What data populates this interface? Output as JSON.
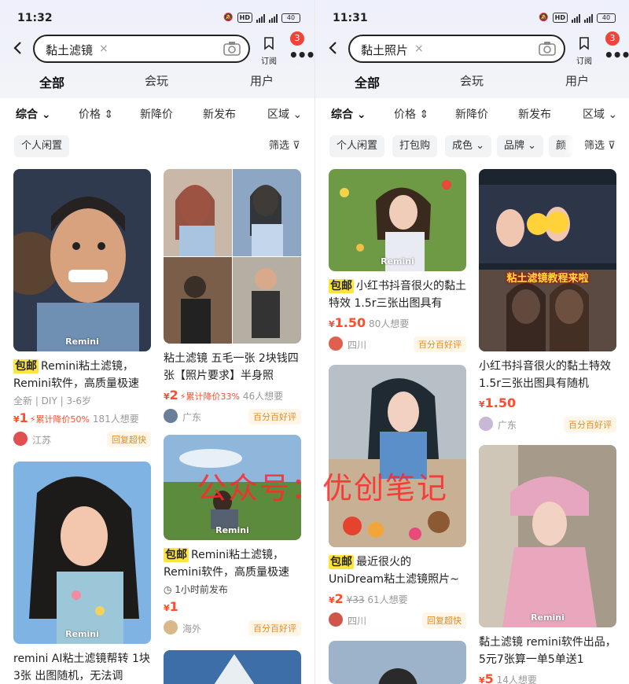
{
  "left": {
    "status": {
      "time": "11:32",
      "battery": "40"
    },
    "search": {
      "query": "黏土滤镜"
    },
    "subscribe_label": "订阅",
    "badge": "3",
    "tabs": [
      "全部",
      "会玩",
      "用户"
    ],
    "sorts": [
      "综合",
      "价格",
      "新降价",
      "新发布",
      "区域"
    ],
    "chips": [
      "个人闲置"
    ],
    "filter": "筛选",
    "cards": [
      {
        "bao": "包邮",
        "title": "Remini粘土滤镜，Remini软件，高质量极速",
        "meta": "全新 | DIY | 3-6岁",
        "price": "1",
        "drop": "累计降价50%",
        "want": "181人想要",
        "loc": "江苏",
        "tag": "回复超快",
        "wm": "Remini"
      },
      {
        "bao": "",
        "title": "粘土滤镜 五毛一张 2块钱四张【照片要求】半身照",
        "meta": "",
        "price": "2",
        "drop": "累计降价33%",
        "want": "46人想要",
        "loc": "广东",
        "tag": "百分百好评",
        "wm": ""
      },
      {
        "bao": "包邮",
        "title": "Remini粘土滤镜，Remini软件，高质量极速",
        "meta": "1小时前发布",
        "price": "1",
        "drop": "",
        "want": "",
        "loc": "海外",
        "tag": "百分百好评",
        "wm": "Remini"
      },
      {
        "bao": "",
        "title": "remini AI粘土滤镜帮转 1块3张 出图随机，无法调",
        "meta": "",
        "price": "",
        "drop": "",
        "want": "",
        "loc": "",
        "tag": "",
        "wm": "Remini"
      }
    ]
  },
  "right": {
    "status": {
      "time": "11:31",
      "battery": "40"
    },
    "search": {
      "query": "黏土照片"
    },
    "subscribe_label": "订阅",
    "badge": "3",
    "tabs": [
      "全部",
      "会玩",
      "用户"
    ],
    "sorts": [
      "综合",
      "价格",
      "新降价",
      "新发布",
      "区域"
    ],
    "chips": [
      "个人闲置",
      "打包购",
      "成色",
      "品牌",
      "颜"
    ],
    "filter": "筛选",
    "cards": [
      {
        "bao": "包邮",
        "title": "小红书抖音很火的黏土特效 1.5r三张出图具有",
        "price": "1.50",
        "want": "80人想要",
        "loc": "四川",
        "tag": "百分百好评",
        "wm": "Remini"
      },
      {
        "bao": "",
        "title": "小红书抖音很火的黏土特效 1.5r三张出图具有随机",
        "price": "1.50",
        "want": "",
        "loc": "广东",
        "tag": "百分百好评",
        "banner": "粘土滤镜教程来啦"
      },
      {
        "bao": "包邮",
        "title": "最近很火的UniDream粘土滤镜照片~",
        "price": "2",
        "orig": "¥33",
        "want": "61人想要",
        "loc": "四川",
        "tag": "回复超快"
      },
      {
        "bao": "",
        "title": "黏土滤镜 remini软件出品，5元7张算一单5单送1",
        "price": "5",
        "want": "14人想要",
        "loc": "",
        "tag": "",
        "wm": "Remini"
      }
    ]
  },
  "overlay": {
    "watermark": "公众号：优创笔记"
  }
}
